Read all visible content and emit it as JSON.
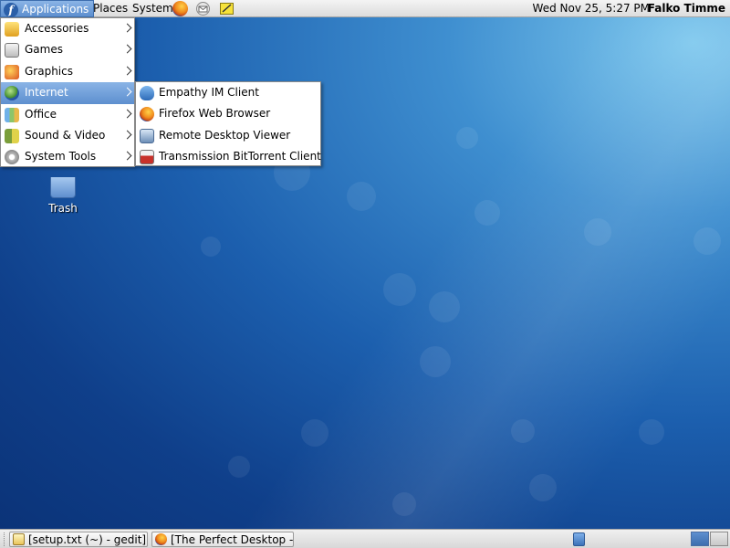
{
  "top_panel": {
    "menus": {
      "applications": "Applications",
      "places": "Places",
      "system": "System"
    },
    "launchers": [
      {
        "icon": "firefox-icon"
      },
      {
        "icon": "mail-icon"
      },
      {
        "icon": "notes-icon"
      }
    ],
    "clock": "Wed Nov 25,  5:27 PM",
    "user": "Falko Timme"
  },
  "applications_menu": {
    "items": [
      {
        "label": "Accessories",
        "icon": "accessories-icon"
      },
      {
        "label": "Games",
        "icon": "games-icon"
      },
      {
        "label": "Graphics",
        "icon": "graphics-icon"
      },
      {
        "label": "Internet",
        "icon": "internet-icon",
        "highlighted": true
      },
      {
        "label": "Office",
        "icon": "office-icon"
      },
      {
        "label": "Sound & Video",
        "icon": "sound-video-icon"
      },
      {
        "label": "System Tools",
        "icon": "system-tools-icon"
      }
    ]
  },
  "internet_submenu": {
    "items": [
      {
        "label": "Empathy IM Client",
        "icon": "empathy-icon"
      },
      {
        "label": "Firefox Web Browser",
        "icon": "firefox-icon"
      },
      {
        "label": "Remote Desktop Viewer",
        "icon": "remote-desktop-icon"
      },
      {
        "label": "Transmission BitTorrent Client",
        "icon": "transmission-icon"
      }
    ]
  },
  "desktop": {
    "trash_label": "Trash"
  },
  "bottom_panel": {
    "tasks": [
      {
        "label": "[setup.txt (~) - gedit]",
        "icon": "gedit-icon"
      },
      {
        "label": "[The Perfect Desktop -...",
        "icon": "firefox-icon"
      }
    ]
  },
  "colors": {
    "highlight": "#5d8fcf",
    "desktop_dark": "#0b3378",
    "desktop_light": "#7ec8ee"
  }
}
